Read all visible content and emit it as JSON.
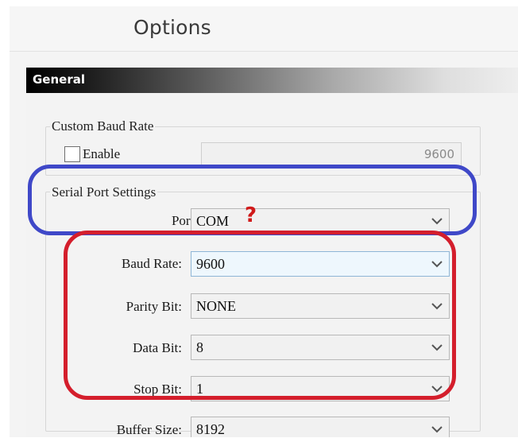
{
  "window": {
    "title": "Options"
  },
  "section": {
    "title": "General"
  },
  "custom_baud": {
    "group_label": "Custom Baud Rate",
    "enable_label": "Enable",
    "enabled": false,
    "value": "9600"
  },
  "serial": {
    "group_label": "Serial Port Settings",
    "port": {
      "label": "Port:",
      "value": "COM",
      "annotation": "?"
    },
    "baud_rate": {
      "label": "Baud Rate:",
      "value": "9600"
    },
    "parity_bit": {
      "label": "Parity Bit:",
      "value": "NONE"
    },
    "data_bit": {
      "label": "Data Bit:",
      "value": "8"
    },
    "stop_bit": {
      "label": "Stop Bit:",
      "value": "1"
    },
    "buffer_size": {
      "label": "Buffer Size:",
      "value": "8192"
    }
  },
  "colors": {
    "annotation_blue": "#3f48c8",
    "annotation_red": "#d41e2c",
    "question_mark": "#d01a1a"
  }
}
